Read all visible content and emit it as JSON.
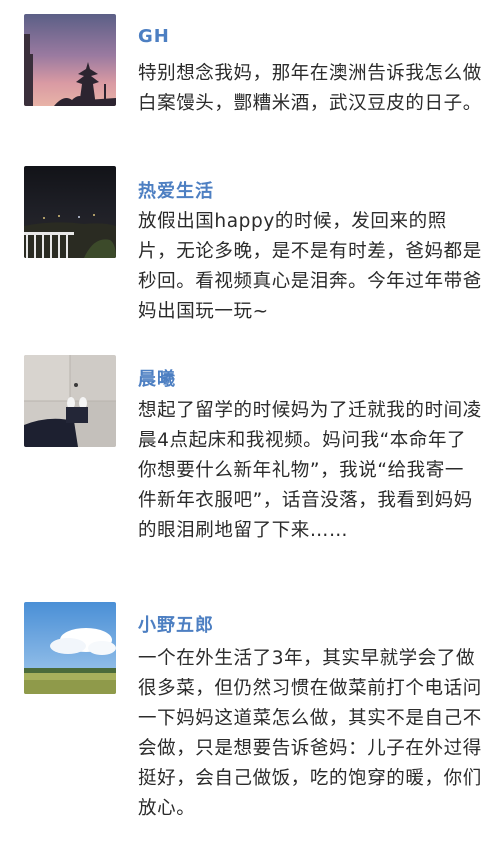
{
  "comments": [
    {
      "name": "GH",
      "text": "特别想念我妈，那年在澳洲告诉我怎么做白案馒头，酆糟米酒，武汉豆皮的日子。",
      "avatar_icon": "sunset-silhouette-photo"
    },
    {
      "name": "热爱生活",
      "text": "放假出国happy的时候，发回来的照片，无论多晚，是不是有时差，爸妈都是秒回。看视频真心是泪奔。今年过年带爸妈出国玩一玩~",
      "avatar_icon": "night-balcony-photo"
    },
    {
      "name": "晨曦",
      "text": "想起了留学的时候妈为了迁就我的时间凌晨4点起床和我视频。妈问我“本命年了你想要什么新年礼物”，我说“给我寄一件新年衣服吧”，话音没落，我看到妈妈的眼泪刷地留了下来……",
      "avatar_icon": "feet-on-floor-photo"
    },
    {
      "name": "小野五郎",
      "text": "一个在外生活了3年，其实早就学会了做很多菜，但仍然习惯在做菜前打个电话问一下妈妈这道菜怎么做，其实不是自己不会做，只是想要告诉爸妈：儿子在外过得挺好，会自己做饭，吃的饱穿的暖，你们放心。",
      "avatar_icon": "sky-field-photo"
    }
  ],
  "colors": {
    "name": "#4d7fc2",
    "text": "#2b2b2b"
  }
}
